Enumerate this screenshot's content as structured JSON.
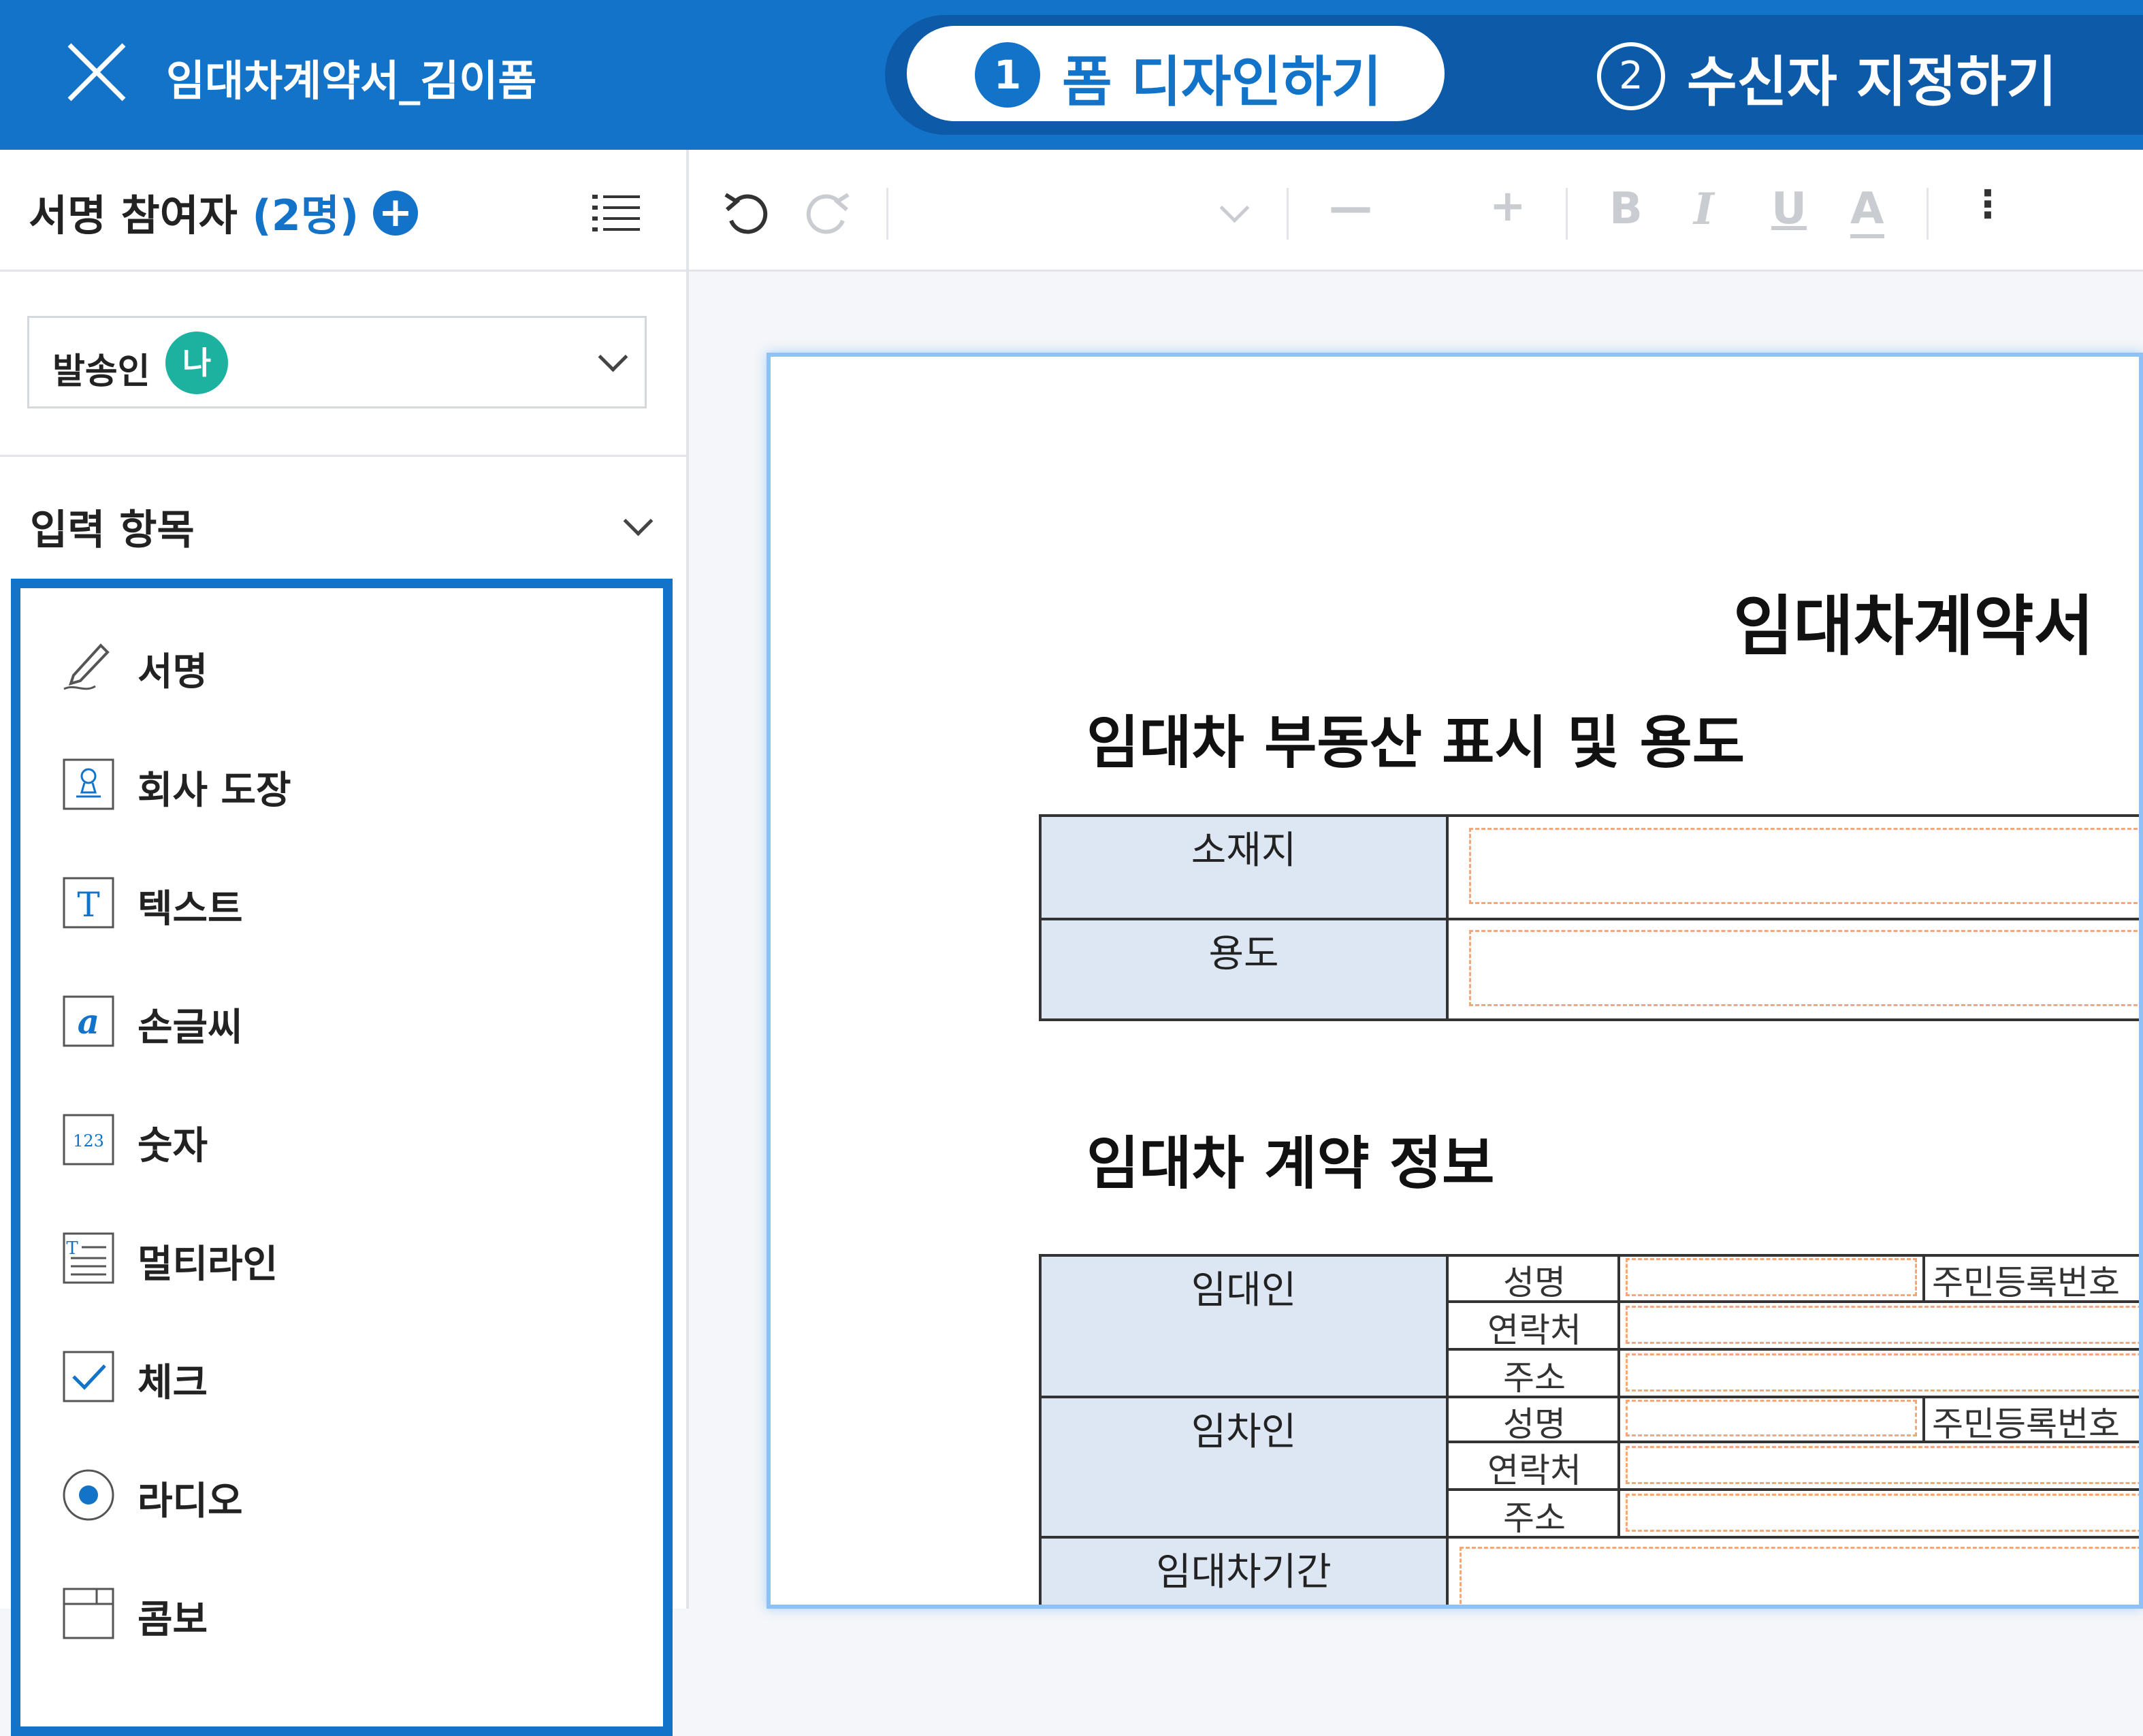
{
  "header": {
    "document_title": "임대차계약서_김이폼",
    "step1": {
      "number": "1",
      "label": "폼 디자인하기"
    },
    "step2": {
      "number": "2",
      "label": "수신자 지정하기"
    }
  },
  "sidebar": {
    "participants_label": "서명 참여자",
    "participants_count": "(2명)",
    "sender": {
      "label": "발송인",
      "badge": "나"
    },
    "items_section_title": "입력 항목",
    "items": [
      {
        "label": "서명",
        "icon": "signature-pen-icon"
      },
      {
        "label": "회사 도장",
        "icon": "stamp-icon"
      },
      {
        "label": "텍스트",
        "icon": "text-icon"
      },
      {
        "label": "손글씨",
        "icon": "handwriting-icon"
      },
      {
        "label": "숫자",
        "icon": "number-icon"
      },
      {
        "label": "멀티라인",
        "icon": "multiline-icon"
      },
      {
        "label": "체크",
        "icon": "checkbox-icon"
      },
      {
        "label": "라디오",
        "icon": "radio-icon"
      },
      {
        "label": "콤보",
        "icon": "combo-icon"
      }
    ]
  },
  "toolbar": {
    "bold": "B",
    "italic": "I",
    "underline": "U",
    "color": "A",
    "minus": "—",
    "plus": "+",
    "more": "⋮"
  },
  "document": {
    "title": "임대차계약서",
    "section1": {
      "title": "임대차 부동산 표시 및 용도",
      "rows": [
        "소재지",
        "용도"
      ]
    },
    "section2": {
      "title": "임대차 계약 정보",
      "lessor": "임대인",
      "lessee": "임차인",
      "fields": [
        "성명",
        "연락처",
        "주소"
      ],
      "resident_no": "주민등록번호",
      "period": "임대차기간"
    }
  },
  "colors": {
    "brand": "#1273c9",
    "badge": "#1db2a0",
    "field_border": "#f3a87a",
    "table_header": "#dde6f3"
  }
}
